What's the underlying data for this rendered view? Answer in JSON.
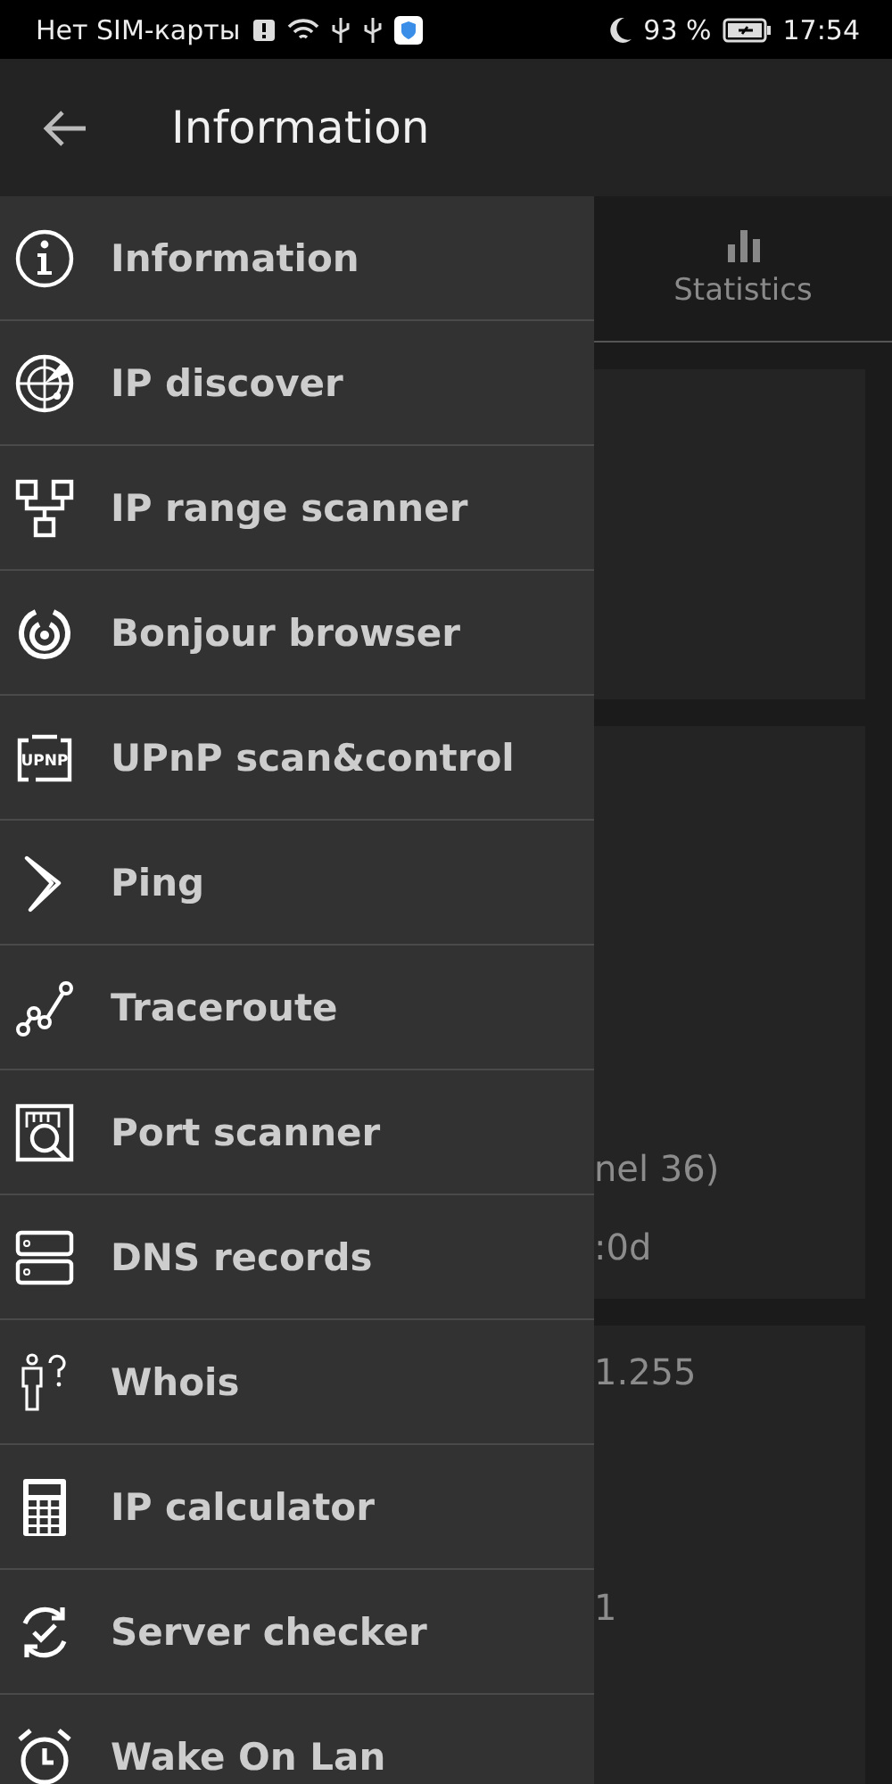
{
  "status_bar": {
    "carrier": "Нет SIM-карты",
    "battery": "93 %",
    "time": "17:54"
  },
  "app_bar": {
    "title": "Information"
  },
  "drawer": {
    "items": [
      {
        "label": "Information"
      },
      {
        "label": "IP discover"
      },
      {
        "label": "IP range scanner"
      },
      {
        "label": "Bonjour browser"
      },
      {
        "label": "UPnP scan&control",
        "icon_text": "UPNP"
      },
      {
        "label": "Ping"
      },
      {
        "label": "Traceroute"
      },
      {
        "label": "Port scanner"
      },
      {
        "label": "DNS records"
      },
      {
        "label": "Whois"
      },
      {
        "label": "IP calculator"
      },
      {
        "label": "Server checker"
      },
      {
        "label": "Wake On Lan"
      }
    ]
  },
  "tabs": [
    {
      "label": "Statistics"
    }
  ],
  "cards": [
    {
      "lines": [
        "nel 36)",
        ":0d"
      ]
    },
    {
      "lines": [
        "1.255",
        "1"
      ]
    }
  ]
}
